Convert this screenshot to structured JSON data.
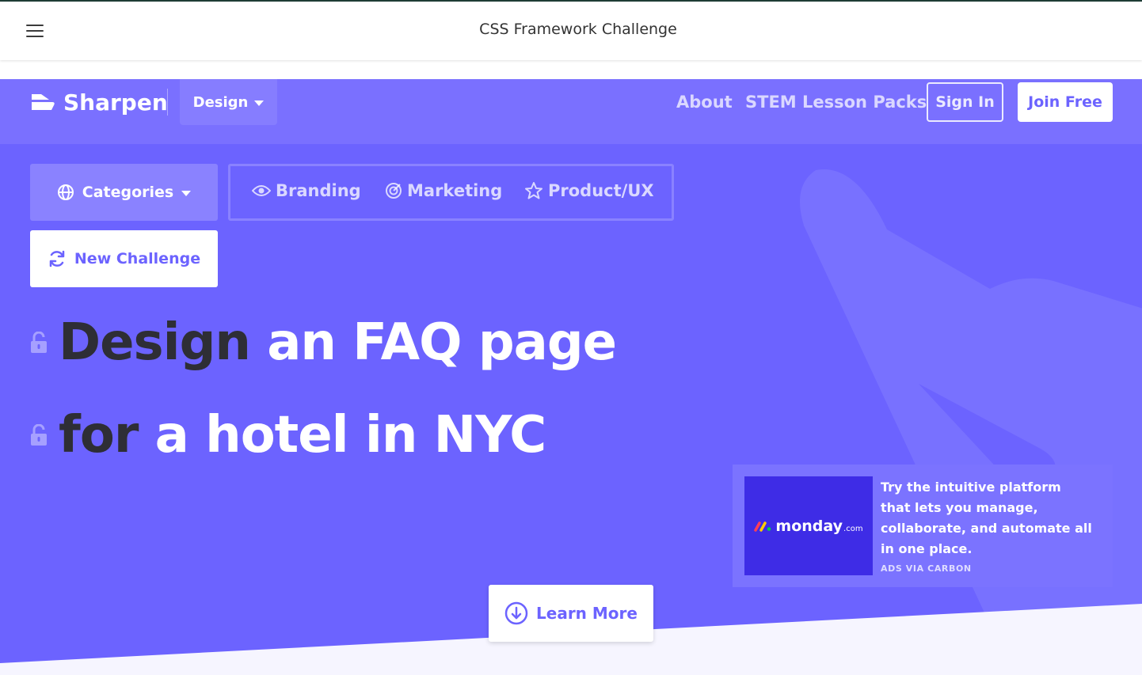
{
  "appbar": {
    "title": "CSS Framework Challenge"
  },
  "nav": {
    "brand": "Sharpen",
    "design_dropdown": "Design",
    "links": [
      "About",
      "STEM Lesson Packs"
    ],
    "sign_in": "Sign In",
    "join_free": "Join Free"
  },
  "filters": {
    "categories": "Categories",
    "tags": [
      "Branding",
      "Marketing",
      "Product/UX"
    ],
    "new_challenge": "New Challenge"
  },
  "headline": {
    "line1": {
      "dark": "Design",
      "light": " an FAQ page"
    },
    "line2": {
      "dark": "for",
      "light": " a hotel in NYC"
    }
  },
  "ad": {
    "brand": "monday",
    "brand_suffix": ".com",
    "text": "Try the intuitive platform that lets you manage, collaborate, and automate all in one place.",
    "via": "ADS VIA CARBON"
  },
  "learn_more": "Learn More",
  "colors": {
    "primary": "#6c63ff",
    "nav_band": "#7a70ff",
    "headline_dark": "#2e2e35",
    "ad_image_bg": "#3e2ce6"
  },
  "icons": {
    "menu": "hamburger-icon",
    "globe": "globe-icon",
    "eye": "eye-icon",
    "target": "target-icon",
    "star": "star-icon",
    "refresh": "refresh-icon",
    "lock": "unlock-icon",
    "arrow_down": "arrow-down-circle-icon"
  }
}
